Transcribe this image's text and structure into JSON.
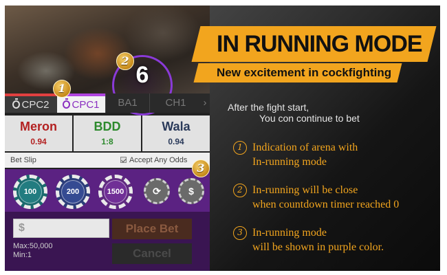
{
  "widget": {
    "countdown": "6",
    "tabs": [
      {
        "label": "CPC2"
      },
      {
        "label": "CPC1"
      },
      {
        "label": "BA1"
      },
      {
        "label": "CH1"
      },
      {
        "label": "›"
      }
    ],
    "odds": [
      {
        "name": "Meron",
        "value": "0.94"
      },
      {
        "name": "BDD",
        "value": "1:8"
      },
      {
        "name": "Wala",
        "value": "0.94"
      }
    ],
    "bet_slip_label": "Bet Slip",
    "accept_label": "Accept Any Odds",
    "chips": [
      "100",
      "200",
      "1500"
    ],
    "amount_placeholder": "$",
    "max_label": "Max:50,000",
    "min_label": "Min:1",
    "place_bet_label": "Place Bet",
    "cancel_label": "Cancel"
  },
  "badges": [
    "1",
    "2",
    "3"
  ],
  "promo": {
    "headline": "IN RUNNING MODE",
    "subheadline": "New excitement in cockfighting",
    "intro_line1": "After the fight start,",
    "intro_line2": "You con continue to bet",
    "points": [
      {
        "num": "1",
        "line1": "Indication of arena with",
        "line2": "In-running mode"
      },
      {
        "num": "2",
        "line1": "In-running will be close",
        "line2": "when countdown timer reached 0"
      },
      {
        "num": "3",
        "line1": "In-running mode",
        "line2": "will be shown in purple color."
      }
    ]
  },
  "colors": {
    "accent_orange": "#f2a51e",
    "running_purple": "#5b2282",
    "cpc2_red": "#e04040"
  }
}
